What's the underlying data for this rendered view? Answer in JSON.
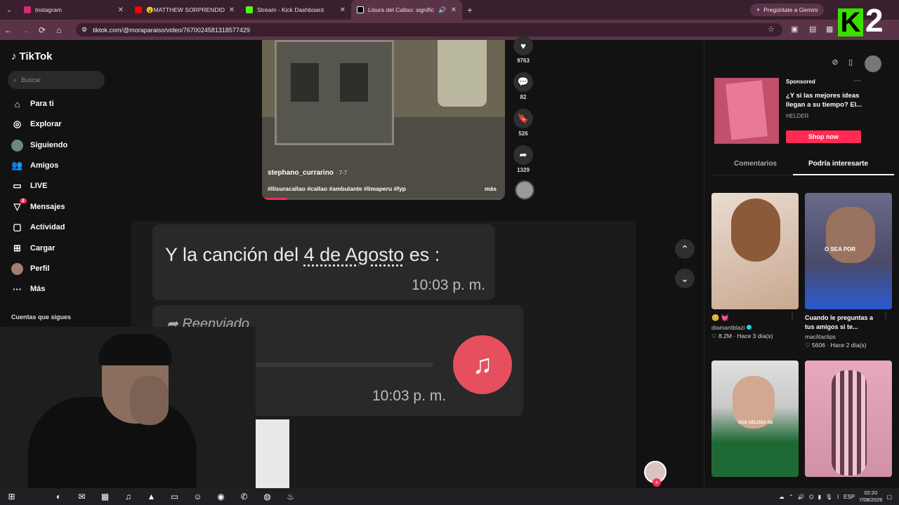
{
  "browser": {
    "tabs": [
      {
        "title": "Instagram",
        "color": "#d62976"
      },
      {
        "title": "😮MATTHEW SORPRENDIDO 😮",
        "color": "#ff0000"
      },
      {
        "title": "Stream - Kick Dashboard",
        "color": "#53fc18"
      },
      {
        "title": "Lisura del Callao: significado",
        "color": "#000000",
        "active": true
      }
    ],
    "gemini_label": "Pregúntale a Gemini",
    "url": "tiktok.com/@moraparaiso/video/7670024581318577429",
    "overlay_logo": {
      "letter": "K",
      "number": "2"
    }
  },
  "sidebar": {
    "logo_text": "TikTok",
    "search_placeholder": "Buscar",
    "items": [
      {
        "label": "Para ti",
        "icon": "home-icon"
      },
      {
        "label": "Explorar",
        "icon": "compass-icon"
      },
      {
        "label": "Siguiendo",
        "icon": "following-avatar-icon"
      },
      {
        "label": "Amigos",
        "icon": "friends-icon"
      },
      {
        "label": "LIVE",
        "icon": "live-icon"
      },
      {
        "label": "Mensajes",
        "icon": "messages-icon",
        "badge": "2"
      },
      {
        "label": "Actividad",
        "icon": "activity-icon"
      },
      {
        "label": "Cargar",
        "icon": "upload-icon"
      },
      {
        "label": "Perfil",
        "icon": "profile-avatar-icon"
      },
      {
        "label": "Más",
        "icon": "more-icon"
      }
    ],
    "following_label": "Cuentas que sigues"
  },
  "video1": {
    "author": "stephano_currarino",
    "date": "· 7-7",
    "hashtags": "#llisuracallao #callao #ambulante #limaperu #fyp",
    "more": "más",
    "progress": 0.1,
    "actions": [
      {
        "icon": "heart-icon",
        "count": "9763"
      },
      {
        "icon": "comment-icon",
        "count": "82"
      },
      {
        "icon": "bookmark-icon",
        "count": "526"
      },
      {
        "icon": "share-icon",
        "count": "1329"
      }
    ]
  },
  "video2": {
    "message_prefix": "Y la canción del ",
    "message_link": "4 de Agosto",
    "message_suffix": " es :",
    "time1": "10:03 p. m.",
    "forwarded": "Reenviado",
    "time2": "10:03 p. m."
  },
  "right": {
    "ad": {
      "sponsored": "Sponsored",
      "title": "¿Y si las mejores ideas llegan a su tiempo? El...",
      "brand": "HELDER",
      "cta": "Shop now"
    },
    "tabs": [
      "Comentarios",
      "Podría interesarte"
    ],
    "cards": [
      {
        "desc": "😊 💓",
        "user": "diamantblazi",
        "likes": "8.2M",
        "time": "· Hace 3 día(s)",
        "verified": true
      },
      {
        "desc": "Cuando le preguntas a tus amigos si te...",
        "user": "maclitaclips",
        "likes": "5606",
        "time": "· Hace 2 día(s)",
        "overlay": "O SEA POR"
      },
      {
        "overlay": "SOS CELOSO DE"
      },
      {}
    ]
  },
  "taskbar": {
    "lang": "ESP",
    "time": "02:20",
    "date": "7/08/2026"
  }
}
